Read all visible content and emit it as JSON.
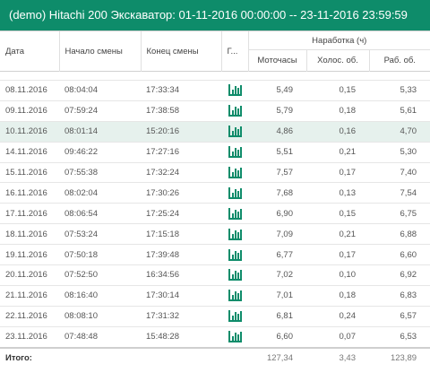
{
  "title": "(demo) Hitachi 200 Экскаватор: 01-11-2016 00:00:00 -- 23-11-2016 23:59:59",
  "accent_color": "#0e8c6a",
  "columns": {
    "date": "Дата",
    "shift_start": "Начало смены",
    "shift_end": "Конец смены",
    "chart": "Г...",
    "group": "Наработка (ч)",
    "engine_hours": "Моточасы",
    "idle": "Холос. об.",
    "work": "Раб. об."
  },
  "chart_icon": "bar-chart-icon",
  "rows": [
    {
      "date": "08.11.2016",
      "start": "08:04:04",
      "end": "17:33:34",
      "engine": "5,49",
      "idle": "0,15",
      "work": "5,33"
    },
    {
      "date": "09.11.2016",
      "start": "07:59:24",
      "end": "17:38:58",
      "engine": "5,79",
      "idle": "0,18",
      "work": "5,61"
    },
    {
      "date": "10.11.2016",
      "start": "08:01:14",
      "end": "15:20:16",
      "engine": "4,86",
      "idle": "0,16",
      "work": "4,70"
    },
    {
      "date": "14.11.2016",
      "start": "09:46:22",
      "end": "17:27:16",
      "engine": "5,51",
      "idle": "0,21",
      "work": "5,30"
    },
    {
      "date": "15.11.2016",
      "start": "07:55:38",
      "end": "17:32:24",
      "engine": "7,57",
      "idle": "0,17",
      "work": "7,40"
    },
    {
      "date": "16.11.2016",
      "start": "08:02:04",
      "end": "17:30:26",
      "engine": "7,68",
      "idle": "0,13",
      "work": "7,54"
    },
    {
      "date": "17.11.2016",
      "start": "08:06:54",
      "end": "17:25:24",
      "engine": "6,90",
      "idle": "0,15",
      "work": "6,75"
    },
    {
      "date": "18.11.2016",
      "start": "07:53:24",
      "end": "17:15:18",
      "engine": "7,09",
      "idle": "0,21",
      "work": "6,88"
    },
    {
      "date": "19.11.2016",
      "start": "07:50:18",
      "end": "17:39:48",
      "engine": "6,77",
      "idle": "0,17",
      "work": "6,60"
    },
    {
      "date": "20.11.2016",
      "start": "07:52:50",
      "end": "16:34:56",
      "engine": "7,02",
      "idle": "0,10",
      "work": "6,92"
    },
    {
      "date": "21.11.2016",
      "start": "08:16:40",
      "end": "17:30:14",
      "engine": "7,01",
      "idle": "0,18",
      "work": "6,83"
    },
    {
      "date": "22.11.2016",
      "start": "08:08:10",
      "end": "17:31:32",
      "engine": "6,81",
      "idle": "0,24",
      "work": "6,57"
    },
    {
      "date": "23.11.2016",
      "start": "07:48:48",
      "end": "15:48:28",
      "engine": "6,60",
      "idle": "0,07",
      "work": "6,53"
    }
  ],
  "selected_row": 2,
  "totals": {
    "label": "Итого:",
    "engine": "127,34",
    "idle": "3,43",
    "work": "123,89"
  }
}
